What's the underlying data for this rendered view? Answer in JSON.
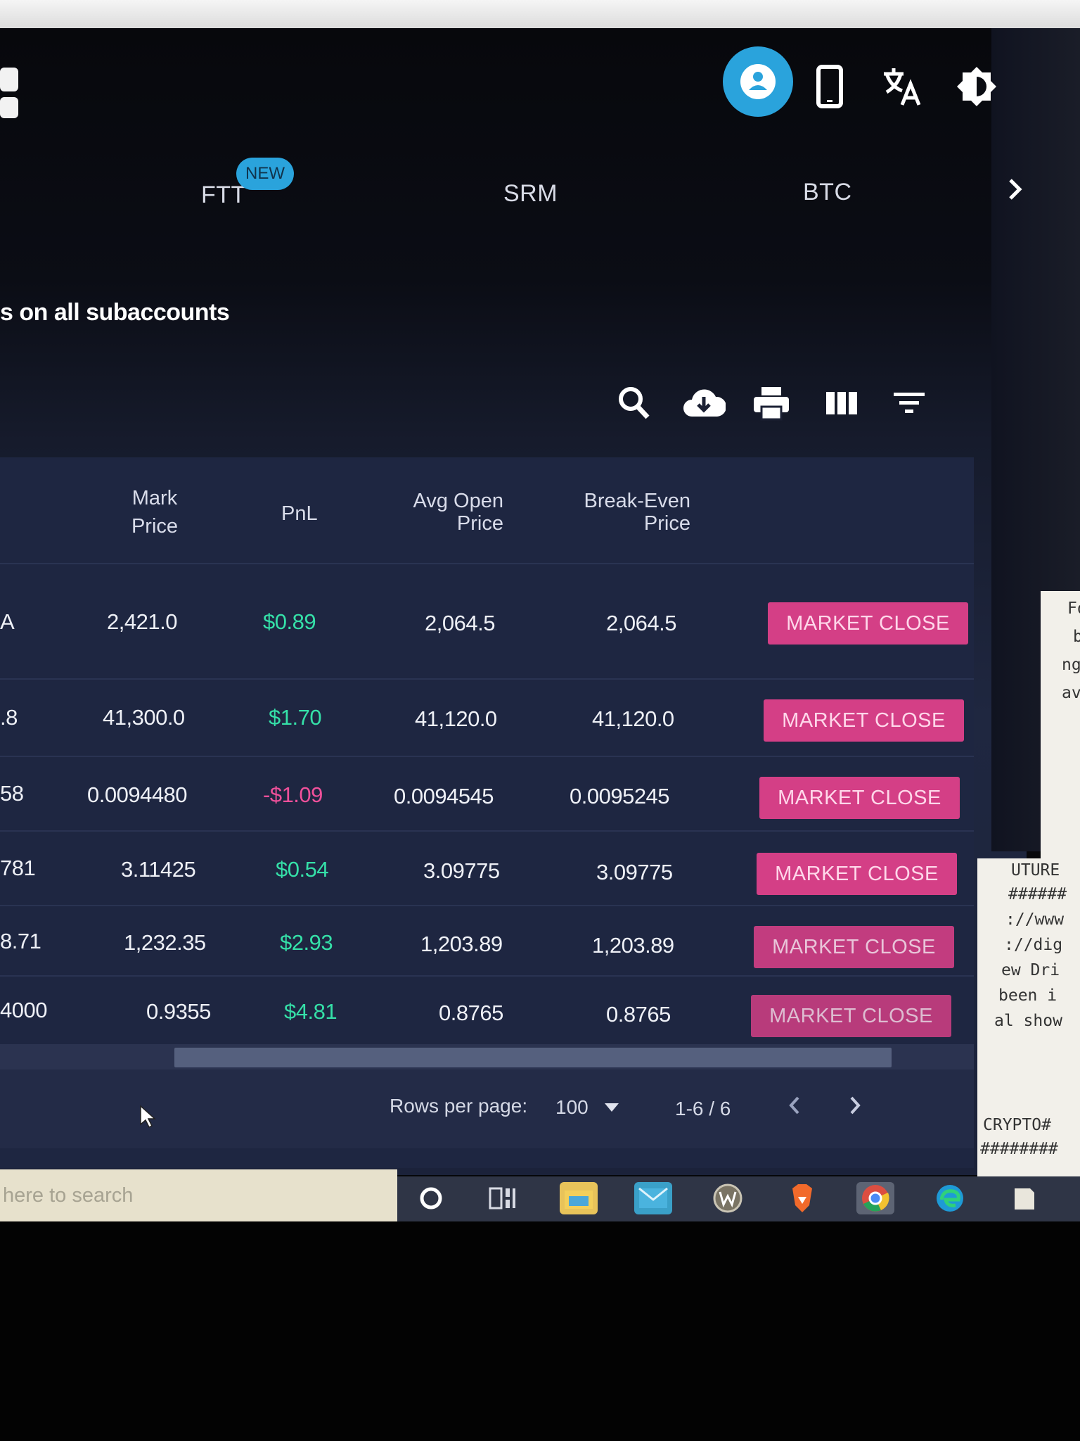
{
  "tabs": [
    {
      "label": "FTT",
      "badge": "NEW"
    },
    {
      "label": "SRM"
    },
    {
      "label": "BTC"
    }
  ],
  "notice": "s on all subaccounts",
  "toolbar_icons": [
    "search-icon",
    "cloud-download-icon",
    "print-icon",
    "columns-icon",
    "filter-icon"
  ],
  "header_icons": [
    "account-icon",
    "mobile-icon",
    "translate-icon",
    "theme-icon"
  ],
  "table": {
    "headers": {
      "mark_price": [
        "Mark",
        "Price"
      ],
      "pnl": "PnL",
      "avg_open": [
        "Avg Open",
        "Price"
      ],
      "break_even": [
        "Break-Even",
        "Price"
      ]
    },
    "rows": [
      {
        "size": "A",
        "mark": "2,421.0",
        "pnl": "$0.89",
        "pnl_sign": "pos",
        "avg": "2,064.5",
        "be": "2,064.5",
        "action": "MARKET CLOSE"
      },
      {
        "size": ".8",
        "mark": "41,300.0",
        "pnl": "$1.70",
        "pnl_sign": "pos",
        "avg": "41,120.0",
        "be": "41,120.0",
        "action": "MARKET CLOSE"
      },
      {
        "size": "58",
        "mark": "0.0094480",
        "pnl": "-$1.09",
        "pnl_sign": "neg",
        "avg": "0.0094545",
        "be": "0.0095245",
        "action": "MARKET CLOSE"
      },
      {
        "size": "781",
        "mark": "3.11425",
        "pnl": "$0.54",
        "pnl_sign": "pos",
        "avg": "3.09775",
        "be": "3.09775",
        "action": "MARKET CLOSE"
      },
      {
        "size": "8.71",
        "mark": "1,232.35",
        "pnl": "$2.93",
        "pnl_sign": "pos",
        "avg": "1,203.89",
        "be": "1,203.89",
        "action": "MARKET CLOSE"
      },
      {
        "size": "4000",
        "mark": "0.9355",
        "pnl": "$4.81",
        "pnl_sign": "pos",
        "avg": "0.8765",
        "be": "0.8765",
        "action": "MARKET CLOSE"
      }
    ]
  },
  "pagination": {
    "rows_per_page_label": "Rows per page:",
    "rows_per_page_value": "100",
    "range": "1-6 / 6"
  },
  "taskbar": {
    "search_placeholder": "here to search"
  },
  "notepad_lines": [
    "UTURE",
    "######",
    "://www",
    "://dig",
    "ew Dri",
    " been i",
    "al show",
    "",
    "CRYPTO#",
    "########"
  ],
  "notepad_top_lines": [
    "Fo",
    "b",
    "ng",
    "av"
  ],
  "colors": {
    "accent": "#2aa3dc",
    "market_close": "#d43f86",
    "pnl_positive": "#35e0a8",
    "pnl_negative": "#f0509a"
  }
}
